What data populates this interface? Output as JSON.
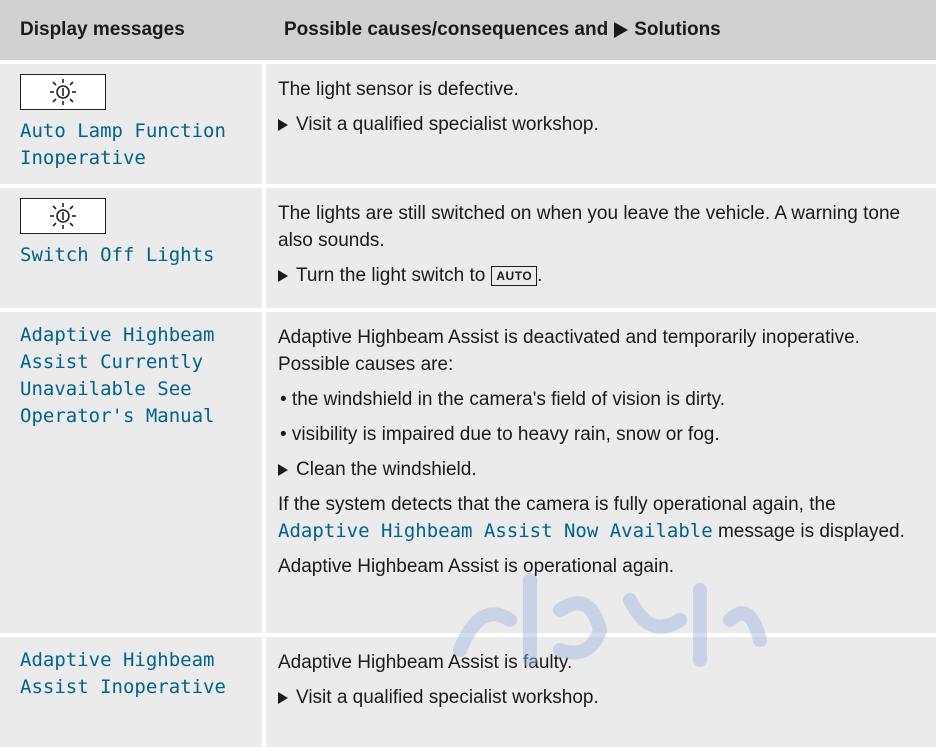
{
  "header": {
    "col1": "Display messages",
    "col2_prefix": "Possible causes/consequences and",
    "col2_suffix": "Solutions"
  },
  "rows": [
    {
      "icon": "light-sensor-icon",
      "message": "Auto Lamp Function Inoperative",
      "text": "The light sensor is defective.",
      "step": "Visit a qualified specialist workshop."
    },
    {
      "icon": "light-sensor-icon",
      "message": "Switch Off Lights",
      "text": "The lights are still switched on when you leave the vehicle. A warning tone also sounds.",
      "step_prefix": "Turn the light switch to",
      "step_key": "AUTO",
      "step_suffix": "."
    },
    {
      "message": "Adaptive Highbeam Assist Currently Unavailable See Operator's Manual",
      "text": "Adaptive Highbeam Assist is deactivated and temporarily inoperative. Possible causes are:",
      "bullets": [
        "• the windshield in the camera's field of vision is dirty.",
        "• visibility is impaired due to heavy rain, snow or fog."
      ],
      "step": "Clean the windshield.",
      "note_prefix": "If the system detects that the camera is fully operational again, the",
      "note_message": "Adaptive Highbeam Assist Now Available",
      "note_suffix": "message is displayed.",
      "note_end": "Adaptive Highbeam Assist is operational again."
    },
    {
      "message": "Adaptive Highbeam Assist Inoperative",
      "text": "Adaptive Highbeam Assist is faulty.",
      "step": "Visit a qualified specialist workshop."
    }
  ],
  "colors": {
    "header_bg": "#d1d1d1",
    "row_bg": "#ebebeb",
    "message_blue": "#00628f"
  }
}
